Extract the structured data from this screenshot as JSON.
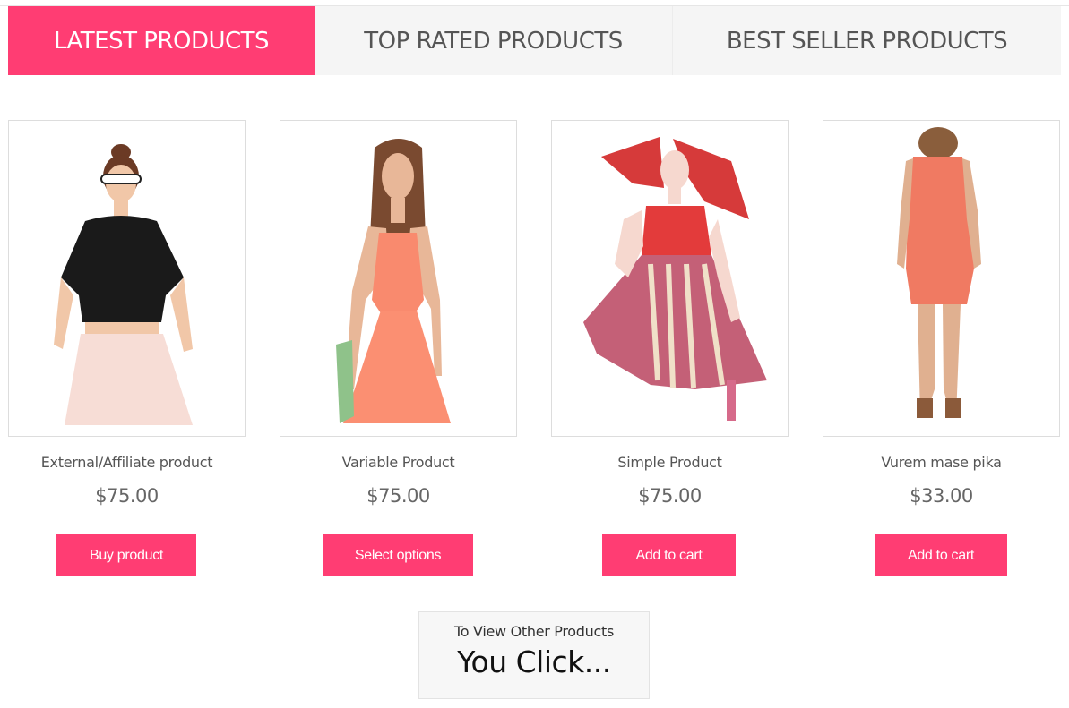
{
  "tabs": [
    {
      "label": "LATEST PRODUCTS",
      "active": true
    },
    {
      "label": "TOP RATED PRODUCTS",
      "active": false
    },
    {
      "label": "BEST SELLER PRODUCTS",
      "active": false
    }
  ],
  "products": [
    {
      "title": "External/Affiliate product",
      "price": "$75.00",
      "button": "Buy product",
      "image": "woman-black-lace-top-pink-skirt"
    },
    {
      "title": "Variable Product",
      "price": "$75.00",
      "button": "Select options",
      "image": "woman-peach-halter-dress"
    },
    {
      "title": "Simple Product",
      "price": "$75.00",
      "button": "Add to cart",
      "image": "woman-red-striped-dress-scarf"
    },
    {
      "title": "Vurem mase pika",
      "price": "$33.00",
      "button": "Add to cart",
      "image": "woman-coral-lace-dress-back"
    }
  ],
  "more": {
    "line1": "To View Other Products",
    "line2": "You Click..."
  },
  "colors": {
    "accent": "#ff3d73",
    "tab_bg": "#f5f5f5",
    "text": "#555555"
  }
}
